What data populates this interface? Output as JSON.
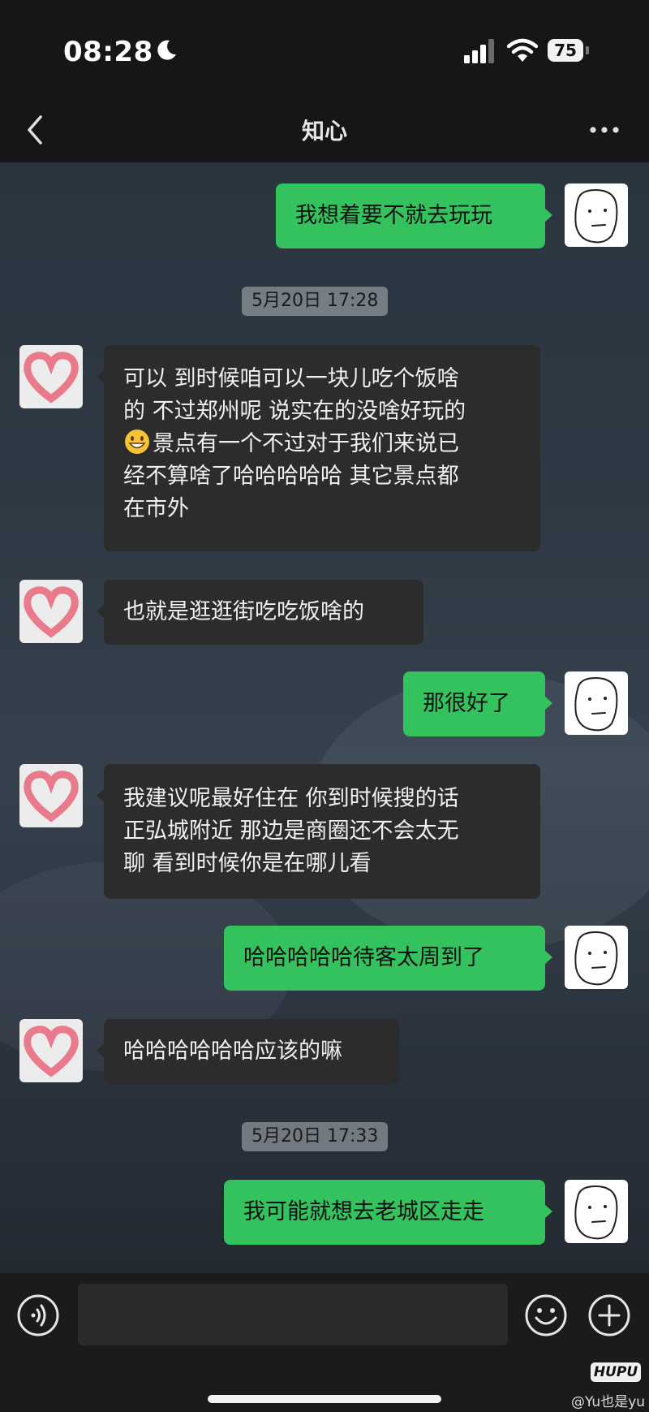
{
  "status_bar": {
    "time": "08:28",
    "battery": "75"
  },
  "header": {
    "title": "知心"
  },
  "messages": [
    {
      "type": "bubble",
      "sender": "me",
      "lines": [
        "我想着要不就去玩玩"
      ]
    },
    {
      "type": "time",
      "text": "5月20日 17:28"
    },
    {
      "type": "bubble",
      "sender": "her",
      "lines": [
        "可以 到时候咱可以一块儿吃个饭啥",
        "的 不过郑州呢 说实在的没啥好玩的",
        "景点有一个不过对于我们来说已",
        "经不算啥了哈哈哈哈哈 其它景点都",
        "在市外"
      ],
      "emoji": "grinning-face-emoji"
    },
    {
      "type": "bubble",
      "sender": "her",
      "lines": [
        "也就是逛逛街吃吃饭啥的"
      ]
    },
    {
      "type": "bubble",
      "sender": "me",
      "lines": [
        "那很好了"
      ]
    },
    {
      "type": "bubble",
      "sender": "her",
      "lines": [
        "我建议呢最好住在 你到时候搜的话",
        "正弘城附近 那边是商圈还不会太无",
        "聊 看到时候你是在哪儿看"
      ]
    },
    {
      "type": "bubble",
      "sender": "me",
      "lines": [
        "哈哈哈哈哈待客太周到了"
      ]
    },
    {
      "type": "bubble",
      "sender": "her",
      "lines": [
        "哈哈哈哈哈哈应该的嘛"
      ]
    },
    {
      "type": "time",
      "text": "5月20日 17:33"
    },
    {
      "type": "bubble",
      "sender": "me",
      "lines": [
        "我可能就想去老城区走走"
      ]
    }
  ],
  "watermark": {
    "logo": "HUPU",
    "user": "@Yu也是yu"
  },
  "colors": {
    "my_bubble": "#33c25e",
    "her_bubble": "#2c2c2c",
    "timestamp_bg": "#aeb3b8"
  },
  "icons": [
    "moon-icon",
    "signal-icon",
    "wifi-icon",
    "battery-icon",
    "back-icon",
    "more-icon",
    "rage-face-avatar",
    "heart-avatar",
    "voice-icon",
    "emoji-icon",
    "plus-icon"
  ]
}
